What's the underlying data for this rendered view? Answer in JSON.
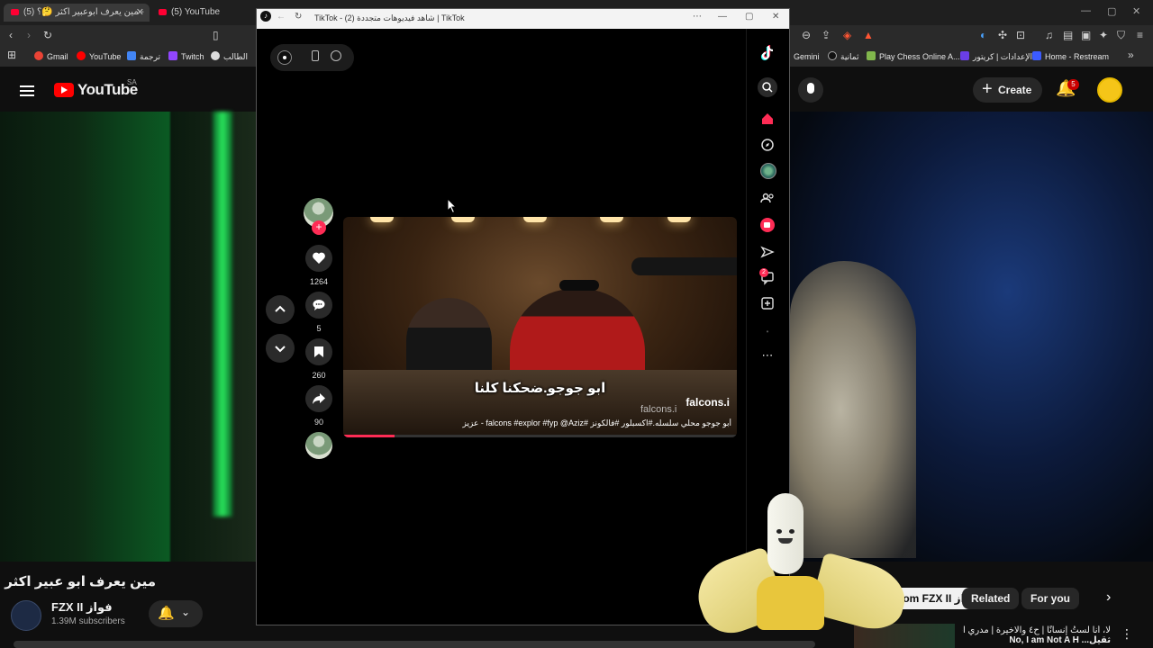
{
  "browser": {
    "tabs": [
      {
        "label": "(5) مين يعرف ابوعبير اكثر 🤔؟ -",
        "active": true
      },
      {
        "label": "(5) YouTube",
        "active": false
      }
    ],
    "bookmarks_left": [
      "Gmail",
      "YouTube",
      "ترجمة",
      "Twitch",
      "الطالب"
    ],
    "bookmarks_right": [
      "Gemini",
      "ثمانية",
      "Play Chess Online A...",
      "الإعدادات | كريتور",
      "Home - Restream"
    ]
  },
  "youtube": {
    "logo_text": "YouTube",
    "region": "SA",
    "create_label": "Create",
    "notification_count": "5",
    "video_title": "مين يعرف ابو عبير اكثر 🤔؟",
    "channel_name": "FZX II فواز",
    "subscribers": "1.39M subscribers",
    "chips": [
      "All from FZX II فواز",
      "Related",
      "For you"
    ],
    "rec_title_line1": "لا، أنا لستُ إنسانًا | ح٤ والاخيرة | مدري انا",
    "rec_title_line2": "No, I am Not A H ...ثقيل"
  },
  "tiktok": {
    "window_title": "TikTok - (2) شاهد فيديوهات متجددة | TikTok",
    "caption": "ابو جوجو.ضحكنا كلنا",
    "author": "falcons.i",
    "watermark": "falcons.i",
    "description": "أبو جوجو محلي سلسله.#اكسبلور #فالكونز #falcons #explor #fyp @Aziz - عزيز",
    "likes": "1264",
    "comments": "5",
    "saves": "260",
    "shares": "90",
    "chat_badge": "2",
    "progress": 0.13,
    "accent": "#fe2c55"
  }
}
